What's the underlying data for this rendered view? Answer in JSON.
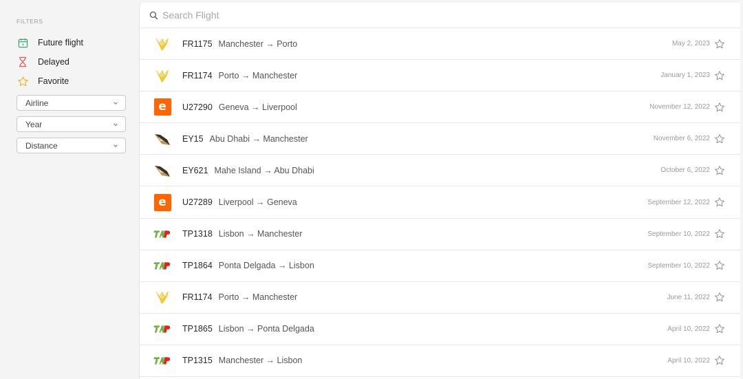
{
  "sidebar": {
    "title": "FILTERS",
    "filters": [
      {
        "label": "Future flight",
        "icon": "calendar-icon"
      },
      {
        "label": "Delayed",
        "icon": "hourglass-icon"
      },
      {
        "label": "Favorite",
        "icon": "star-icon"
      }
    ],
    "selects": [
      {
        "label": "Airline"
      },
      {
        "label": "Year"
      },
      {
        "label": "Distance"
      }
    ]
  },
  "search": {
    "placeholder": "Search Flight",
    "value": ""
  },
  "flights": [
    {
      "airline": "ryanair",
      "code": "FR1175",
      "route": "Manchester → Porto",
      "date": "May 2, 2023"
    },
    {
      "airline": "ryanair",
      "code": "FR1174",
      "route": "Porto → Manchester",
      "date": "January 1, 2023"
    },
    {
      "airline": "easyjet",
      "code": "U27290",
      "route": "Geneva → Liverpool",
      "date": "November 12, 2022"
    },
    {
      "airline": "etihad",
      "code": "EY15",
      "route": "Abu Dhabi → Manchester",
      "date": "November 6, 2022"
    },
    {
      "airline": "etihad",
      "code": "EY621",
      "route": "Mahe Island → Abu Dhabi",
      "date": "October 6, 2022"
    },
    {
      "airline": "easyjet",
      "code": "U27289",
      "route": "Liverpool → Geneva",
      "date": "September 12, 2022"
    },
    {
      "airline": "tap",
      "code": "TP1318",
      "route": "Lisbon → Manchester",
      "date": "September 10, 2022"
    },
    {
      "airline": "tap",
      "code": "TP1864",
      "route": "Ponta Delgada → Lisbon",
      "date": "September 10, 2022"
    },
    {
      "airline": "ryanair",
      "code": "FR1174",
      "route": "Porto → Manchester",
      "date": "June 11, 2022"
    },
    {
      "airline": "tap",
      "code": "TP1865",
      "route": "Lisbon → Ponta Delgada",
      "date": "April 10, 2022"
    },
    {
      "airline": "tap",
      "code": "TP1315",
      "route": "Manchester → Lisbon",
      "date": "April 10, 2022"
    }
  ],
  "colors": {
    "accent_green": "#3aa876",
    "accent_red": "#e25b5b",
    "accent_yellow": "#f0b429",
    "easyjet": "#ff6600",
    "ryanair": "#f1c933",
    "tap_red": "#e2231a",
    "tap_green": "#6fb43f"
  }
}
